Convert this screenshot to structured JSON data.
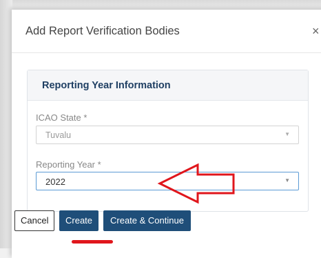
{
  "dialog": {
    "title": "Add Report Verification Bodies",
    "close_glyph": "×"
  },
  "panel": {
    "title": "Reporting Year Information"
  },
  "fields": {
    "icao_state": {
      "label": "ICAO State *",
      "value": "Tuvalu",
      "disabled": true
    },
    "reporting_year": {
      "label": "Reporting Year *",
      "value": "2022"
    }
  },
  "buttons": {
    "cancel": "Cancel",
    "create": "Create",
    "create_continue": "Create & Continue"
  },
  "annotation_color": "#e0161c",
  "accent_color": "#1f4e79"
}
